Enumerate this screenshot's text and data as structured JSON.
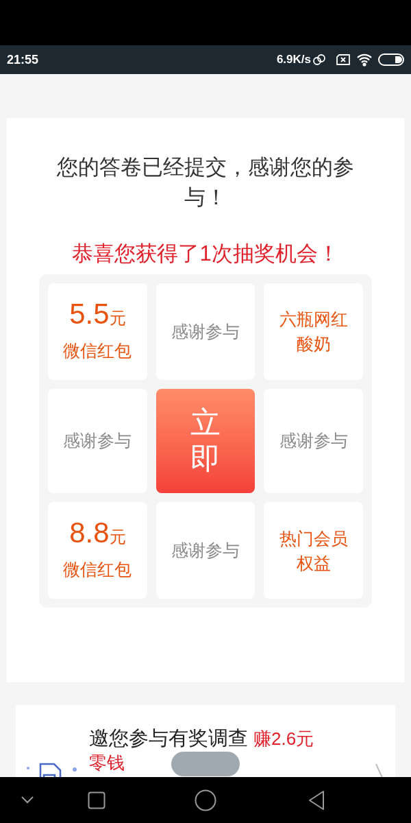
{
  "status_bar": {
    "time": "21:55",
    "speed": "6.9K/s"
  },
  "result": {
    "message": "您的答卷已经提交，感谢您的参与！",
    "prize_note": "恭喜您获得了1次抽奖机会！"
  },
  "lottery": {
    "cells": [
      {
        "kind": "prize",
        "amount": "5.5",
        "unit": "元",
        "label": "微信红包"
      },
      {
        "kind": "thanks",
        "label": "感谢参与"
      },
      {
        "kind": "gift",
        "label": "六瓶网红酸奶"
      },
      {
        "kind": "thanks",
        "label": "感谢参与"
      },
      {
        "kind": "start",
        "label": "立即"
      },
      {
        "kind": "thanks",
        "label": "感谢参与"
      },
      {
        "kind": "prize",
        "amount": "8.8",
        "unit": "元",
        "label": "微信红包"
      },
      {
        "kind": "thanks",
        "label": "感谢参与"
      },
      {
        "kind": "gift",
        "label": "热门会员权益"
      }
    ]
  },
  "survey_card": {
    "title": "邀您参与有奖调查",
    "reward": "赚2.6元",
    "reward_unit": "零钱"
  }
}
